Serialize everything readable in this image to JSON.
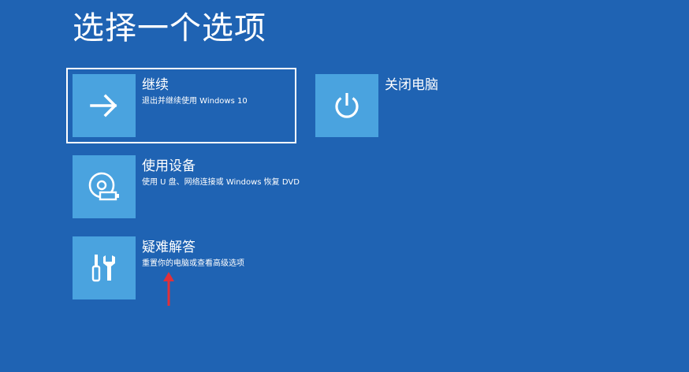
{
  "page": {
    "title": "选择一个选项"
  },
  "options": [
    {
      "id": "continue",
      "icon": "arrow-right-icon",
      "label": "继续",
      "description": "退出并继续使用 Windows 10"
    },
    {
      "id": "shutdown",
      "icon": "power-icon",
      "label": "关闭电脑",
      "description": ""
    },
    {
      "id": "use-device",
      "icon": "disc-usb-icon",
      "label": "使用设备",
      "description": "使用 U 盘、网络连接或 Windows 恢复 DVD"
    },
    {
      "id": "troubleshoot",
      "icon": "screwdriver-wrench-icon",
      "label": "疑难解答",
      "description": "重置你的电脑或查看高级选项"
    }
  ],
  "colors": {
    "background": "#1f63b3",
    "tile": "#4aa3df",
    "annotation_arrow": "#e0303a"
  }
}
